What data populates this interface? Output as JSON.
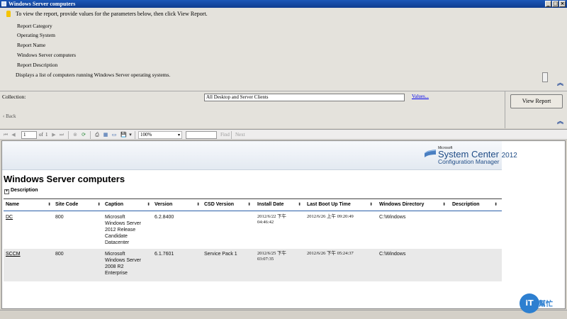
{
  "window": {
    "title": "Windows Server computers",
    "buttons": [
      "_",
      "□",
      "×"
    ]
  },
  "params": {
    "instructions": "To view the report, provide values for the parameters below, then click View Report.",
    "labels": [
      "Report Category",
      "Operating System",
      "Report Name",
      "Windows Server computers",
      "Report Description"
    ],
    "description": "Displays a list of computers running Windows Server operating systems."
  },
  "filter": {
    "collection_label": "Collection:",
    "collection_value": "All Desktop and Server Clients",
    "values_link": "Values...",
    "back_link": "‹ Back",
    "view_report_button": "View Report"
  },
  "toolbar": {
    "page_current": "1",
    "page_of": "of",
    "page_total": "1",
    "zoom": "100%",
    "find": "Find",
    "next": "Next"
  },
  "report": {
    "banner": {
      "microsoft": "Microsoft",
      "product": "System Center",
      "year": "2012",
      "subtitle": "Configuration Manager"
    },
    "title": "Windows Server computers",
    "description_toggle": "Description",
    "columns": [
      "Name",
      "Site Code",
      "Caption",
      "Version",
      "CSD Version",
      "Install Date",
      "Last Boot Up Time",
      "Windows Directory",
      "Description"
    ],
    "rows": [
      {
        "name": "DC",
        "site_code": "800",
        "caption": [
          "Microsoft",
          "Windows Server",
          "2012 Release",
          "Candidate",
          "Datacenter"
        ],
        "version": "6.2.8400",
        "csd_version": "",
        "install_date": [
          "2012/6/22 下午",
          "04:46:42"
        ],
        "last_boot": "2012/6/26 上午 09:20:49",
        "windows_directory": "C:\\Windows",
        "description": ""
      },
      {
        "name": "SCCM",
        "site_code": "800",
        "caption": [
          "Microsoft",
          "Windows Server",
          "2008 R2",
          "Enterprise"
        ],
        "version": "6.1.7601",
        "csd_version": "Service Pack 1",
        "install_date": [
          "2012/6/25 下午",
          "03:07:35"
        ],
        "last_boot": "2012/6/26 下午 05:24:37",
        "windows_directory": "C:\\Windows",
        "description": ""
      }
    ]
  },
  "watermark": {
    "badge": "iT",
    "text": "幫忙"
  },
  "colors": {
    "title_bar": "#1c57b8",
    "link": "#0000ee",
    "brand_blue": "#1f4c86",
    "alt_row": "#e9e9e9"
  }
}
